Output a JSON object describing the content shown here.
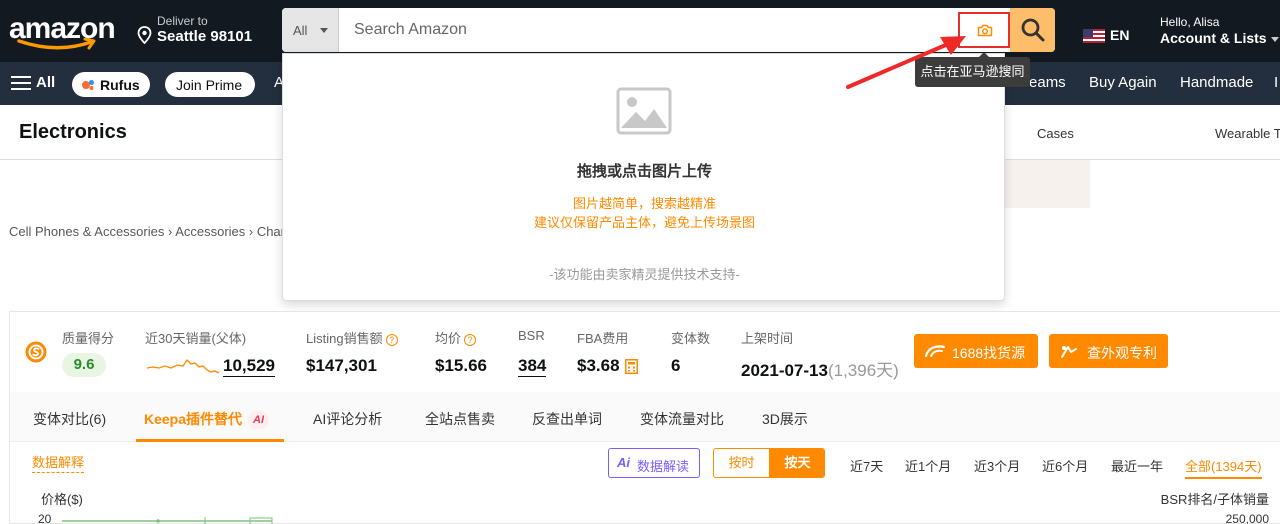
{
  "header": {
    "logo_text": "amazon",
    "deliver_line1": "Deliver to",
    "deliver_line2": "Seattle 98101",
    "search": {
      "category": "All",
      "placeholder": "Search Amazon"
    },
    "language": "EN",
    "account_line1": "Hello, Alisa",
    "account_line2": "Account & Lists"
  },
  "nav": {
    "all": "All",
    "rufus": "Rufus",
    "join_prime": "Join Prime",
    "partial_item": "A",
    "livestreams": "estreams",
    "buy_again": "Buy Again",
    "handmade": "Handmade",
    "partial_end": "I"
  },
  "category_bar": {
    "title": "Electronics",
    "cases": "Cases",
    "wearable": "Wearable T"
  },
  "breadcrumb": "Cell Phones & Accessories › Accessories › Char",
  "image_search": {
    "title": "拖拽或点击图片上传",
    "hint1": "图片越简单，搜索越精准",
    "hint2": "建议仅保留产品主体，避免上传场景图",
    "credit": "-该功能由卖家精灵提供技术支持-"
  },
  "tooltip": "点击在亚马逊搜同款",
  "stats": {
    "quality_label": "质量得分",
    "quality_value": "9.6",
    "sales30_label": "近30天销量(父体)",
    "sales30_value": "10,529",
    "revenue_label": "Listing销售额",
    "revenue_value": "$147,301",
    "avg_price_label": "均价",
    "avg_price_value": "$15.66",
    "bsr_label": "BSR",
    "bsr_value": "384",
    "fba_label": "FBA费用",
    "fba_value": "$3.68",
    "variants_label": "变体数",
    "variants_value": "6",
    "listed_label": "上架时间",
    "listed_value": "2021-07-13",
    "listed_days": "(1,396天)",
    "btn_1688": "1688找货源",
    "btn_patent": "查外观专利"
  },
  "tabs": [
    {
      "label": "变体对比(6)"
    },
    {
      "label": "Keepa插件替代"
    },
    {
      "label": "AI评论分析"
    },
    {
      "label": "全站点售卖"
    },
    {
      "label": "反查出单词"
    },
    {
      "label": "变体流量对比"
    },
    {
      "label": "3D展示"
    }
  ],
  "ai_badge": "AI",
  "toolbar": {
    "data_explain": "数据解释",
    "ai_read_ai": "Ai",
    "ai_read": "数据解读",
    "by_hour": "按时",
    "by_day": "按天",
    "ranges": [
      "近7天",
      "近1个月",
      "近3个月",
      "近6个月",
      "最近一年",
      "全部(1394天)"
    ]
  },
  "chart": {
    "left_axis": "价格($)",
    "right_axis": "BSR排名/子体销量",
    "left_tick": "20",
    "right_tick": "250,000"
  },
  "colors": {
    "amazon_dark": "#131921",
    "amazon_nav": "#232f3e",
    "search_button": "#febd69",
    "accent_orange": "#ff8a00",
    "highlight_red": "#e52e2e"
  }
}
